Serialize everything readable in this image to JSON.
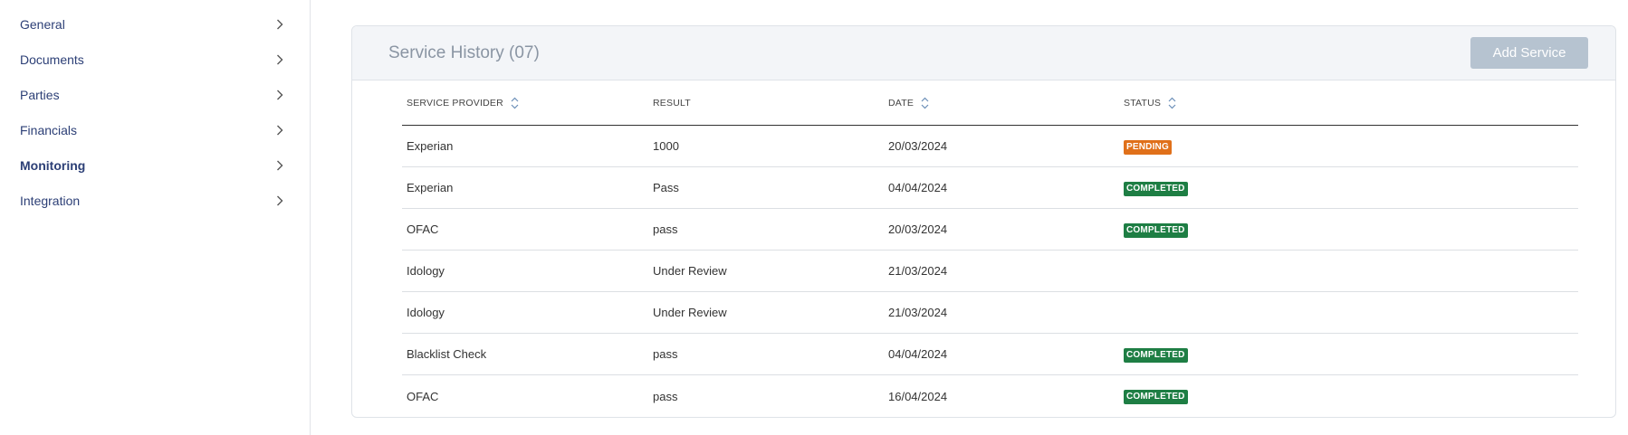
{
  "sidebar": {
    "items": [
      {
        "label": "General",
        "active": false
      },
      {
        "label": "Documents",
        "active": false
      },
      {
        "label": "Parties",
        "active": false
      },
      {
        "label": "Financials",
        "active": false
      },
      {
        "label": "Monitoring",
        "active": true
      },
      {
        "label": "Integration",
        "active": false
      }
    ]
  },
  "service_history": {
    "title": "Service History (07)",
    "add_button_label": "Add Service",
    "columns": [
      "SERVICE PROVIDER",
      "RESULT",
      "DATE",
      "STATUS"
    ],
    "rows": [
      {
        "provider": "Experian",
        "result": "1000",
        "date": "20/03/2024",
        "status": "PENDING"
      },
      {
        "provider": "Experian",
        "result": "Pass",
        "date": "04/04/2024",
        "status": "COMPLETED"
      },
      {
        "provider": "OFAC",
        "result": "pass",
        "date": "20/03/2024",
        "status": "COMPLETED"
      },
      {
        "provider": "Idology",
        "result": "Under Review",
        "date": "21/03/2024",
        "status": ""
      },
      {
        "provider": "Idology",
        "result": "Under Review",
        "date": "21/03/2024",
        "status": ""
      },
      {
        "provider": "Blacklist Check",
        "result": "pass",
        "date": "04/04/2024",
        "status": "COMPLETED"
      },
      {
        "provider": "OFAC",
        "result": "pass",
        "date": "16/04/2024",
        "status": "COMPLETED"
      }
    ]
  },
  "colors": {
    "nav_text": "#2c3f76",
    "pending": "#e0701a",
    "completed": "#1e7e44",
    "button_bg": "#b6c3d0"
  },
  "icons": {
    "nav_chevron": "chevron-right-icon",
    "sort": "sort-updown-icon"
  }
}
